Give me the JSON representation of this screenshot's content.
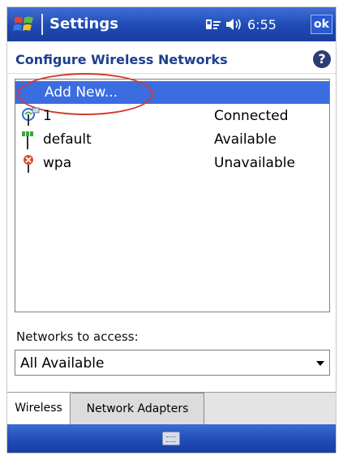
{
  "titlebar": {
    "title": "Settings",
    "time": "6:55",
    "ok_label": "ok",
    "icons": [
      "windows-start-icon",
      "connectivity-icon",
      "volume-icon"
    ]
  },
  "header": {
    "title": "Configure Wireless Networks",
    "help_label": "?"
  },
  "networks": {
    "add_new_label": "Add New...",
    "items": [
      {
        "name": "1",
        "status": "Connected",
        "icon": "wifi-connected-icon"
      },
      {
        "name": "default",
        "status": "Available",
        "icon": "wifi-available-icon"
      },
      {
        "name": "wpa",
        "status": "Unavailable",
        "icon": "wifi-unavailable-icon"
      }
    ]
  },
  "access": {
    "label": "Networks to access:",
    "selected": "All Available"
  },
  "tabs": [
    {
      "label": "Wireless",
      "active": true
    },
    {
      "label": "Network Adapters",
      "active": false
    }
  ],
  "colors": {
    "titlebar": "#1f49b4",
    "selection": "#3c6de0",
    "annotation": "#d23b2b",
    "heading": "#1d3f8e"
  }
}
